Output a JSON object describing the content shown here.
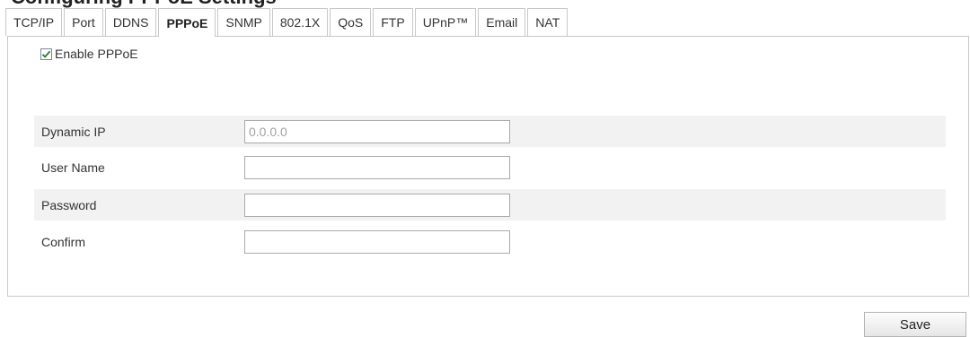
{
  "page_heading": "Configuring PPPoE Settings",
  "tabs": [
    {
      "label": "TCP/IP",
      "active": false
    },
    {
      "label": "Port",
      "active": false
    },
    {
      "label": "DDNS",
      "active": false
    },
    {
      "label": "PPPoE",
      "active": true
    },
    {
      "label": "SNMP",
      "active": false
    },
    {
      "label": "802.1X",
      "active": false
    },
    {
      "label": "QoS",
      "active": false
    },
    {
      "label": "FTP",
      "active": false
    },
    {
      "label": "UPnP™",
      "active": false
    },
    {
      "label": "Email",
      "active": false
    },
    {
      "label": "NAT",
      "active": false
    }
  ],
  "pppoe": {
    "enable_label": "Enable PPPoE",
    "enable_checked": true,
    "dynamic_ip_label": "Dynamic IP",
    "dynamic_ip_value": "0.0.0.0",
    "user_name_label": "User Name",
    "user_name_value": "",
    "password_label": "Password",
    "password_value": "",
    "confirm_label": "Confirm",
    "confirm_value": ""
  },
  "actions": {
    "save_label": "Save"
  },
  "colors": {
    "border": "#c8c8c8",
    "row_shade": "#f2f2f2",
    "checkmark": "#2e7d32"
  }
}
